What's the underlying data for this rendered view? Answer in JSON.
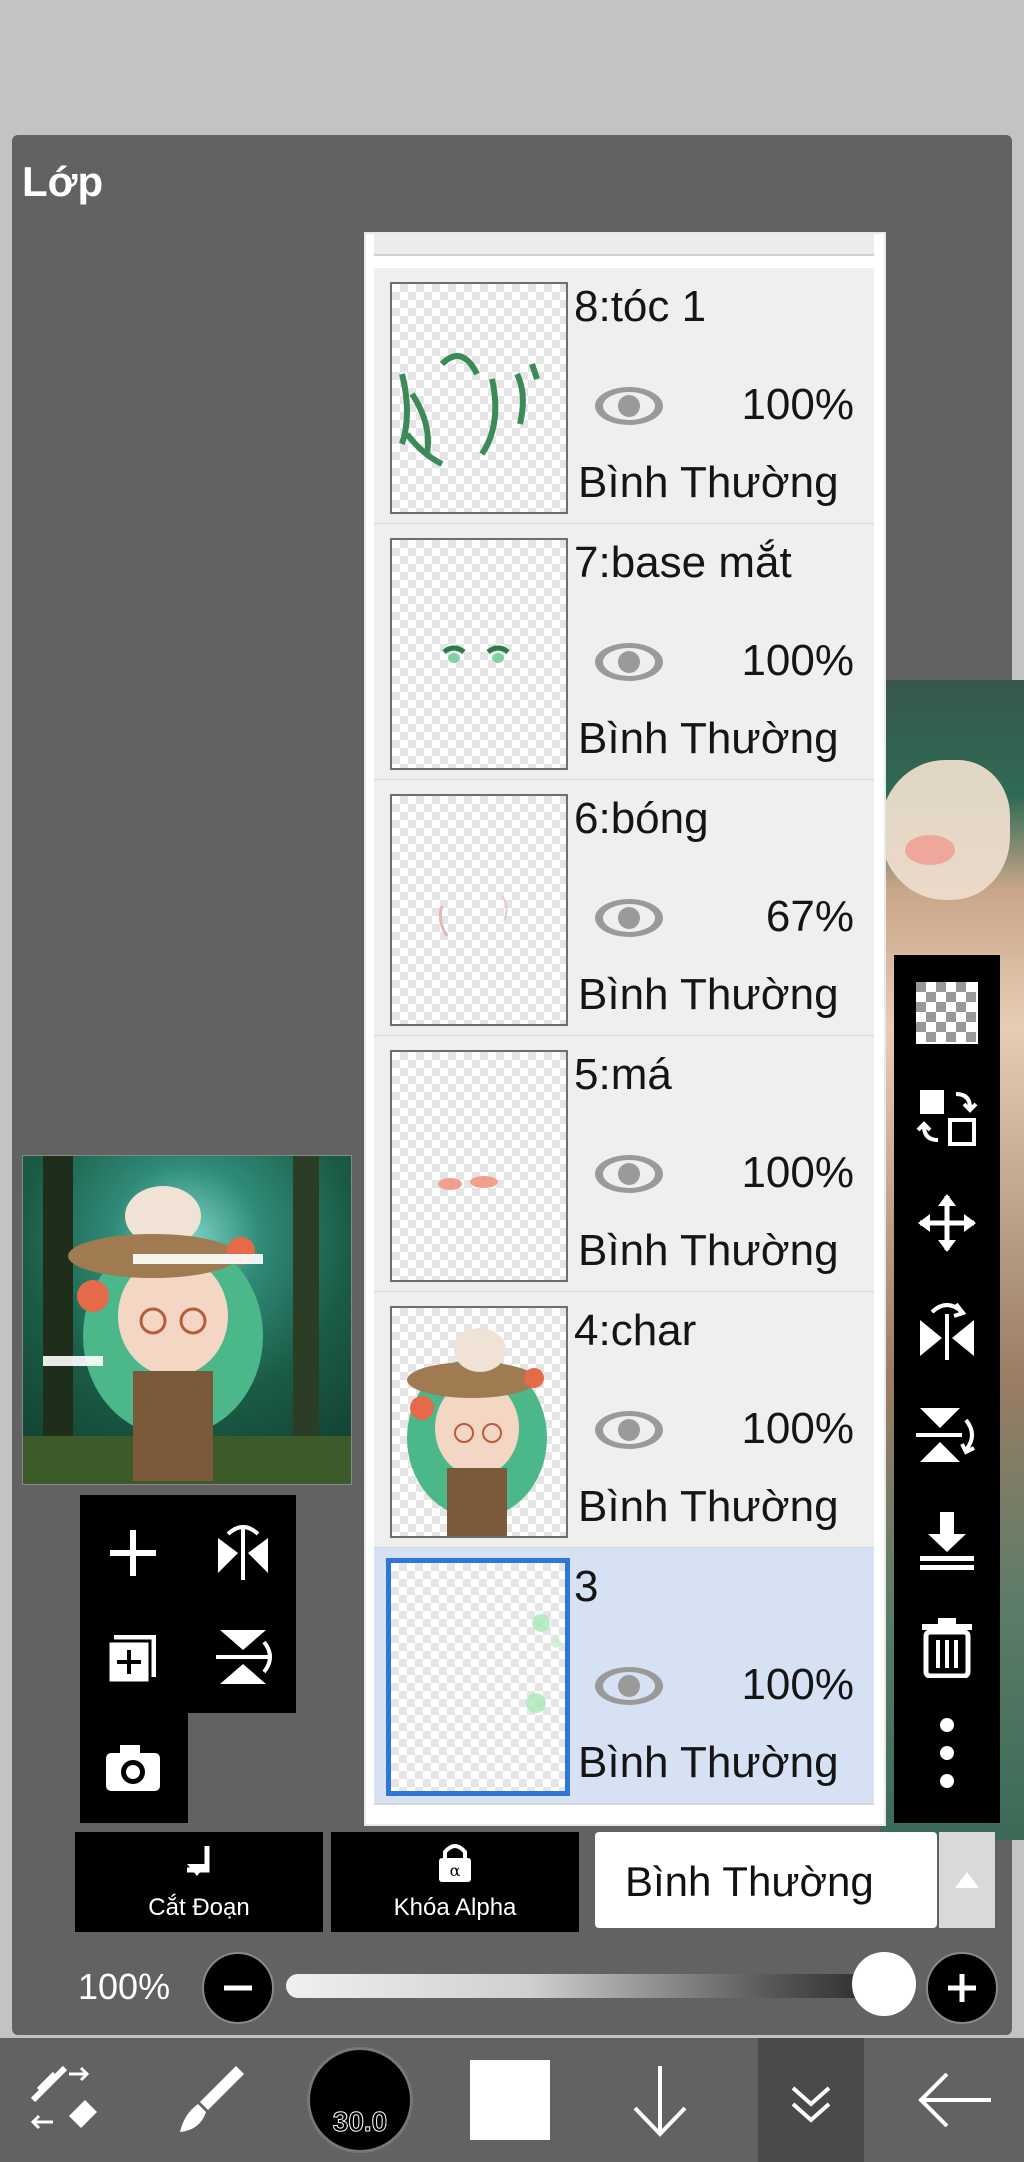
{
  "panel_title": "Lớp",
  "layers": [
    {
      "name": "8:tóc 1",
      "opacity": "100%",
      "blend": "Bình Thường",
      "visible": true,
      "selected": false
    },
    {
      "name": "7:base mắt",
      "opacity": "100%",
      "blend": "Bình Thường",
      "visible": true,
      "selected": false
    },
    {
      "name": "6:bóng",
      "opacity": "67%",
      "blend": "Bình Thường",
      "visible": true,
      "selected": false
    },
    {
      "name": "5:má",
      "opacity": "100%",
      "blend": "Bình Thường",
      "visible": true,
      "selected": false
    },
    {
      "name": "4:char",
      "opacity": "100%",
      "blend": "Bình Thường",
      "visible": true,
      "selected": false
    },
    {
      "name": "3",
      "opacity": "100%",
      "blend": "Bình Thường",
      "visible": true,
      "selected": true
    }
  ],
  "actions": {
    "clipping_label": "Cắt Đoạn",
    "alpha_lock_label": "Khóa Alpha",
    "blend_mode_value": "Bình Thường"
  },
  "opacity_slider": {
    "label": "100%",
    "value": 1.0
  },
  "bottom_toolbar": {
    "brush_size": "30.0"
  },
  "right_toolbar": {
    "icons": [
      "transparent-fill-icon",
      "swap-layer-icon",
      "move-icon",
      "flip-horizontal-icon",
      "flip-vertical-icon",
      "merge-down-icon",
      "trash-icon",
      "more-icon"
    ]
  },
  "colors": {
    "dialog_bg": "#626262",
    "selected_row": "#d6e2f4",
    "selected_border": "#2f76d6",
    "toolbar_bg": "#000000"
  }
}
